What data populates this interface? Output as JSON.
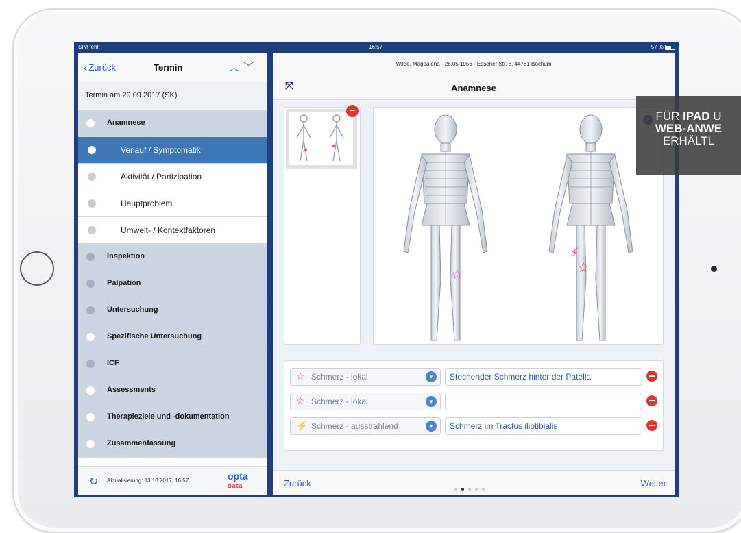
{
  "status_bar": {
    "carrier": "SIM fehlt",
    "time": "16:57",
    "battery": "57 %"
  },
  "left_panel": {
    "back_label": "Zurück",
    "title": "Termin",
    "appointment": "Termin am 29.09.2017 (SK)",
    "items": [
      {
        "label": "Anamnese",
        "type": "cat",
        "dot": "white"
      },
      {
        "label": "Verlauf / Symptomatik",
        "type": "sel",
        "dot": "white"
      },
      {
        "label": "Aktivität / Partizipation",
        "type": "sub",
        "dot": "grey"
      },
      {
        "label": "Hauptproblem",
        "type": "sub",
        "dot": "grey"
      },
      {
        "label": "Umwelt- / Kontextfaktoren",
        "type": "sub",
        "dot": "grey"
      },
      {
        "label": "Inspektion",
        "type": "cat",
        "dot": "grey"
      },
      {
        "label": "Palpation",
        "type": "cat",
        "dot": "grey"
      },
      {
        "label": "Untersuchung",
        "type": "cat",
        "dot": "grey"
      },
      {
        "label": "Spezifische Untersuchung",
        "type": "cat",
        "dot": "white"
      },
      {
        "label": "ICF",
        "type": "cat",
        "dot": "grey"
      },
      {
        "label": "Assessments",
        "type": "cat",
        "dot": "white"
      },
      {
        "label": "Therapieziele und -dokumentation",
        "type": "cat",
        "dot": "white"
      },
      {
        "label": "Zusammenfassung",
        "type": "cat",
        "dot": "white"
      }
    ],
    "update_text": "Aktualisierung: 13.10.2017, 16:57",
    "logo_top": "opta",
    "logo_bottom": "data"
  },
  "right_panel": {
    "patient": "Wilde, Magdalena - 26.05.1956 - Essener Str. 8, 44781 Bochum",
    "title": "Anamnese",
    "symptoms": [
      {
        "type": "Schmerz - lokal",
        "desc": "Stechender Schmerz hinter der Patella",
        "symbol": "☆",
        "color": "#e83ad6"
      },
      {
        "type": "Schmerz - lokal",
        "desc": "",
        "symbol": "☆",
        "color": "#e5342c"
      },
      {
        "type": "Schmerz - ausstrahlend",
        "desc": "Schmerz im Tractus iliotibialis",
        "symbol": "⚡",
        "color": "#e83ad6"
      }
    ],
    "footer_back": "Zurück",
    "footer_next": "Weiter",
    "page_dots": 5,
    "current_page": 2
  },
  "overlay": {
    "line1_a": "FÜR ",
    "line1_b": "IPAD",
    "line1_c": " U",
    "line2": "WEB-ANWE",
    "line3": "ERHÄLTL"
  },
  "colors": {
    "brand_blue": "#1f3e7c",
    "selected": "#3d78b5",
    "category_bg": "#cbd5e3",
    "link": "#2b63c4",
    "delete": "#e5342c"
  }
}
